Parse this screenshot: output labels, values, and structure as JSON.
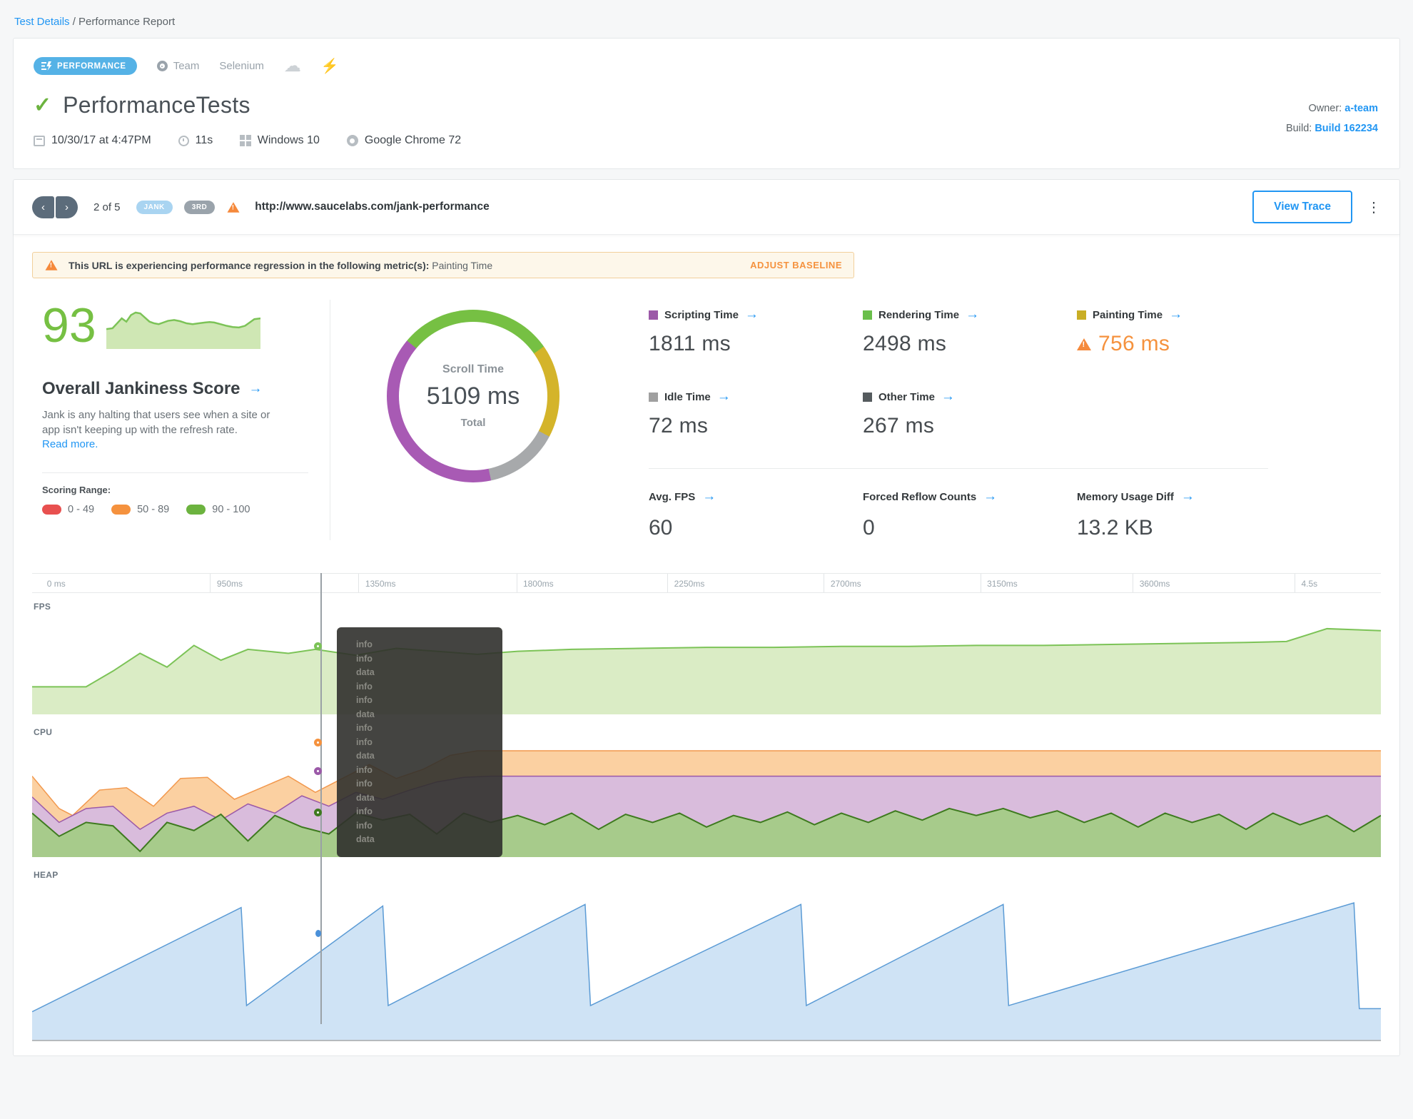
{
  "breadcrumb": {
    "link": "Test Details",
    "separator": "/",
    "current": "Performance Report"
  },
  "header": {
    "badge": "PERFORMANCE",
    "team_label": "Team",
    "framework": "Selenium",
    "title": "PerformanceTests",
    "meta": {
      "date": "10/30/17 at 4:47PM",
      "duration": "11s",
      "os": "Windows 10",
      "browser": "Google Chrome 72"
    },
    "owner_label": "Owner:",
    "owner": "a-team",
    "build_label": "Build:",
    "build": "Build 162234"
  },
  "nav": {
    "position": "2 of 5",
    "badge_jank": "JANK",
    "badge_ord": "3RD",
    "url": "http://www.saucelabs.com/jank-performance",
    "view_trace": "View Trace",
    "kebab": "⋮",
    "prev": "‹",
    "next": "›"
  },
  "alert": {
    "bold": "This URL is experiencing performance regression in the following metric(s):",
    "metric": "Painting Time",
    "action": "ADJUST BASELINE"
  },
  "score": {
    "value": "93",
    "title": "Overall Jankiness Score",
    "arrow": "→",
    "description": "Jank is any halting that users see when a site or app isn't keeping up with the refresh rate.",
    "read_more": "Read more.",
    "scoring_range_label": "Scoring Range:",
    "ranges": [
      {
        "label": "0 - 49",
        "color": "#e8504f"
      },
      {
        "label": "50 - 89",
        "color": "#f5923e"
      },
      {
        "label": "90 - 100",
        "color": "#6cb33f"
      }
    ]
  },
  "donut": {
    "label_top": "Scroll Time",
    "value": "5109 ms",
    "label_bottom": "Total",
    "segments": [
      {
        "name": "rendering",
        "color": "#76c043",
        "from": 0,
        "to": 55
      },
      {
        "name": "painting",
        "color": "#d4b42a",
        "from": 55,
        "to": 118
      },
      {
        "name": "idle-other",
        "color": "#a7a9ab",
        "from": 118,
        "to": 168
      },
      {
        "name": "scripting",
        "color": "#a85ab4",
        "from": 168,
        "to": 310
      },
      {
        "name": "rendering2",
        "color": "#76c043",
        "from": 310,
        "to": 360
      }
    ]
  },
  "metrics": {
    "arrow": "→",
    "items": [
      {
        "label": "Scripting Time",
        "value": "1811 ms",
        "color": "#9c59a8",
        "warn": false
      },
      {
        "label": "Rendering Time",
        "value": "2498 ms",
        "color": "#6abf4b",
        "warn": false
      },
      {
        "label": "Painting Time",
        "value": "756 ms",
        "color": "#c9ae25",
        "warn": true
      },
      {
        "label": "Idle Time",
        "value": "72 ms",
        "color": "#a0a0a0",
        "warn": false
      },
      {
        "label": "Other Time",
        "value": "267 ms",
        "color": "#555b5e",
        "warn": false
      }
    ],
    "summary": [
      {
        "label": "Avg. FPS",
        "value": "60"
      },
      {
        "label": "Forced Reflow Counts",
        "value": "0"
      },
      {
        "label": "Memory Usage Diff",
        "value": "13.2 KB"
      }
    ]
  },
  "timeline": {
    "sections": [
      "FPS",
      "CPU",
      "HEAP"
    ],
    "ticks": [
      {
        "label": "0 ms",
        "x": 1.1,
        "line": false
      },
      {
        "label": "950ms",
        "x": 13.2
      },
      {
        "label": "1350ms",
        "x": 24.2
      },
      {
        "label": "1800ms",
        "x": 35.9
      },
      {
        "label": "2250ms",
        "x": 47.1
      },
      {
        "label": "2700ms",
        "x": 58.7
      },
      {
        "label": "3150ms",
        "x": 70.3
      },
      {
        "label": "3600ms",
        "x": 81.6
      },
      {
        "label": "4.5s",
        "x": 93.6
      }
    ],
    "cursor_x_percent": 21.4,
    "tooltip_rows": [
      "info",
      "info",
      "data",
      "info",
      "info",
      "data",
      "info",
      "info",
      "data",
      "info",
      "info",
      "data",
      "info",
      "info",
      "data"
    ]
  },
  "chart_data": [
    {
      "id": "jankiness-score-sparkline",
      "type": "area",
      "target": "sparkline-svg",
      "title": "Overall Jankiness Score history",
      "ylim": [
        0,
        100
      ],
      "series": [
        {
          "name": "score",
          "stroke": "#7cc357",
          "fill": "#cfe7b4",
          "stroke_width": 2.5,
          "points": [
            [
              0,
              52
            ],
            [
              4,
              50
            ],
            [
              7,
              38
            ],
            [
              10,
              26
            ],
            [
              13,
              34
            ],
            [
              16,
              18
            ],
            [
              19,
              12
            ],
            [
              22,
              14
            ],
            [
              25,
              24
            ],
            [
              28,
              34
            ],
            [
              31,
              38
            ],
            [
              34,
              40
            ],
            [
              37,
              36
            ],
            [
              40,
              32
            ],
            [
              44,
              30
            ],
            [
              48,
              33
            ],
            [
              52,
              38
            ],
            [
              56,
              40
            ],
            [
              60,
              38
            ],
            [
              64,
              36
            ],
            [
              67,
              35
            ],
            [
              70,
              36
            ],
            [
              74,
              40
            ],
            [
              78,
              44
            ],
            [
              82,
              47
            ],
            [
              86,
              48
            ],
            [
              90,
              44
            ],
            [
              93,
              36
            ],
            [
              96,
              28
            ],
            [
              100,
              26
            ]
          ]
        }
      ]
    },
    {
      "id": "fps-timeline",
      "type": "area",
      "target": "fps-svg",
      "title": "FPS over time",
      "x_range_ms": [
        0,
        4500
      ],
      "series": [
        {
          "name": "fps",
          "stroke": "#7cc357",
          "fill": "#daecc5",
          "stroke_width": 2,
          "points": [
            [
              0,
              72
            ],
            [
              4,
              72
            ],
            [
              6,
              56
            ],
            [
              8,
              38
            ],
            [
              10,
              52
            ],
            [
              12,
              30
            ],
            [
              14,
              45
            ],
            [
              16,
              34
            ],
            [
              19,
              38
            ],
            [
              21,
              34
            ],
            [
              24,
              40
            ],
            [
              27,
              33
            ],
            [
              30,
              36
            ],
            [
              33,
              39
            ],
            [
              36,
              36
            ],
            [
              40,
              34
            ],
            [
              45,
              33
            ],
            [
              50,
              32
            ],
            [
              55,
              32
            ],
            [
              60,
              31
            ],
            [
              65,
              31
            ],
            [
              70,
              30
            ],
            [
              75,
              30
            ],
            [
              80,
              29
            ],
            [
              85,
              28
            ],
            [
              90,
              27
            ],
            [
              93,
              26
            ],
            [
              96,
              13
            ],
            [
              100,
              15
            ]
          ]
        }
      ]
    },
    {
      "id": "cpu-timeline",
      "type": "stacked-area",
      "target": "cpu-svg",
      "title": "CPU over time",
      "x_range_ms": [
        0,
        4500
      ],
      "series": [
        {
          "name": "cpu-orange",
          "stroke": "#f2984d",
          "fill": "#fbd0a1",
          "stroke_width": 1.5,
          "points": [
            [
              0,
              30
            ],
            [
              2,
              58
            ],
            [
              3,
              64
            ],
            [
              5,
              42
            ],
            [
              7,
              40
            ],
            [
              9,
              56
            ],
            [
              11,
              32
            ],
            [
              13,
              31
            ],
            [
              15,
              50
            ],
            [
              17,
              40
            ],
            [
              19,
              30
            ],
            [
              21,
              44
            ],
            [
              23,
              32
            ],
            [
              25,
              20
            ],
            [
              27,
              32
            ],
            [
              29,
              24
            ],
            [
              31,
              12
            ],
            [
              33,
              8
            ],
            [
              60,
              8
            ],
            [
              100,
              8
            ]
          ]
        },
        {
          "name": "cpu-purple",
          "stroke": "#9b59a8",
          "fill": "#d9bcdc",
          "stroke_width": 1.5,
          "points": [
            [
              0,
              48
            ],
            [
              2,
              70
            ],
            [
              4,
              58
            ],
            [
              6,
              56
            ],
            [
              8,
              76
            ],
            [
              10,
              62
            ],
            [
              12,
              56
            ],
            [
              14,
              68
            ],
            [
              16,
              54
            ],
            [
              18,
              62
            ],
            [
              20,
              47
            ],
            [
              22,
              56
            ],
            [
              24,
              44
            ],
            [
              26,
              50
            ],
            [
              28,
              42
            ],
            [
              30,
              35
            ],
            [
              32,
              31
            ],
            [
              34,
              30
            ],
            [
              70,
              30
            ],
            [
              100,
              30
            ]
          ]
        },
        {
          "name": "cpu-green",
          "stroke": "#3e7a1f",
          "fill": "#a7cb8b",
          "stroke_width": 2,
          "points": [
            [
              0,
              62
            ],
            [
              2,
              82
            ],
            [
              4,
              70
            ],
            [
              6,
              73
            ],
            [
              8,
              95
            ],
            [
              10,
              70
            ],
            [
              12,
              77
            ],
            [
              14,
              63
            ],
            [
              16,
              86
            ],
            [
              18,
              64
            ],
            [
              20,
              74
            ],
            [
              22,
              80
            ],
            [
              24,
              62
            ],
            [
              26,
              68
            ],
            [
              28,
              63
            ],
            [
              30,
              80
            ],
            [
              32,
              62
            ],
            [
              34,
              70
            ],
            [
              36,
              64
            ],
            [
              38,
              72
            ],
            [
              40,
              62
            ],
            [
              42,
              76
            ],
            [
              44,
              63
            ],
            [
              46,
              70
            ],
            [
              48,
              62
            ],
            [
              50,
              74
            ],
            [
              52,
              64
            ],
            [
              54,
              70
            ],
            [
              56,
              61
            ],
            [
              58,
              72
            ],
            [
              60,
              62
            ],
            [
              62,
              70
            ],
            [
              64,
              60
            ],
            [
              66,
              68
            ],
            [
              68,
              58
            ],
            [
              70,
              64
            ],
            [
              72,
              58
            ],
            [
              74,
              66
            ],
            [
              76,
              60
            ],
            [
              78,
              70
            ],
            [
              80,
              62
            ],
            [
              82,
              74
            ],
            [
              84,
              62
            ],
            [
              86,
              70
            ],
            [
              88,
              63
            ],
            [
              90,
              76
            ],
            [
              92,
              62
            ],
            [
              94,
              72
            ],
            [
              96,
              64
            ],
            [
              98,
              78
            ],
            [
              100,
              64
            ]
          ]
        }
      ]
    },
    {
      "id": "heap-timeline",
      "type": "area",
      "target": "heap-svg",
      "title": "HEAP over time (sawtooth GC pattern)",
      "x_range_ms": [
        0,
        4500
      ],
      "series": [
        {
          "name": "heap",
          "stroke": "#5b9bd5",
          "fill": "#cfe3f5",
          "stroke_width": 1.5,
          "points": [
            [
              0,
              82
            ],
            [
              15.5,
              15
            ],
            [
              15.9,
              78
            ],
            [
              26,
              14
            ],
            [
              26.4,
              78
            ],
            [
              41,
              13
            ],
            [
              41.4,
              78
            ],
            [
              57,
              13
            ],
            [
              57.4,
              78
            ],
            [
              72,
              13
            ],
            [
              72.4,
              78
            ],
            [
              98,
              12
            ],
            [
              98.4,
              80
            ],
            [
              100,
              80
            ]
          ]
        }
      ]
    }
  ]
}
